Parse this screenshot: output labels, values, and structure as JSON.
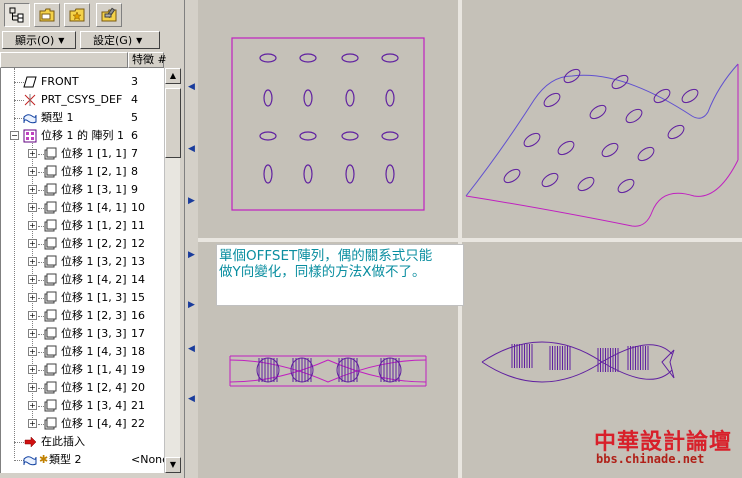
{
  "menus": {
    "display_label": "顯示(O)",
    "settings_label": "設定(G)"
  },
  "tree_header": {
    "feature_col": "特徵 #"
  },
  "tree": {
    "items": [
      {
        "label": "",
        "num": ""
      },
      {
        "label": "FRONT",
        "num": "3"
      },
      {
        "label": "PRT_CSYS_DEF",
        "num": "4"
      },
      {
        "label": "類型 1",
        "num": "5"
      },
      {
        "label": "位移 1 的 陣列 1",
        "num": "6"
      },
      {
        "label": "位移 1 [1, 1]",
        "num": "7"
      },
      {
        "label": "位移 1 [2, 1]",
        "num": "8"
      },
      {
        "label": "位移 1 [3, 1]",
        "num": "9"
      },
      {
        "label": "位移 1 [4, 1]",
        "num": "10"
      },
      {
        "label": "位移 1 [1, 2]",
        "num": "11"
      },
      {
        "label": "位移 1 [2, 2]",
        "num": "12"
      },
      {
        "label": "位移 1 [3, 2]",
        "num": "13"
      },
      {
        "label": "位移 1 [4, 2]",
        "num": "14"
      },
      {
        "label": "位移 1 [1, 3]",
        "num": "15"
      },
      {
        "label": "位移 1 [2, 3]",
        "num": "16"
      },
      {
        "label": "位移 1 [3, 3]",
        "num": "17"
      },
      {
        "label": "位移 1 [4, 3]",
        "num": "18"
      },
      {
        "label": "位移 1 [1, 4]",
        "num": "19"
      },
      {
        "label": "位移 1 [2, 4]",
        "num": "20"
      },
      {
        "label": "位移 1 [3, 4]",
        "num": "21"
      },
      {
        "label": "位移 1 [4, 4]",
        "num": "22"
      },
      {
        "label": "在此插入",
        "num": ""
      },
      {
        "label": "類型 2",
        "num": "<None"
      }
    ]
  },
  "annotation": {
    "line1": "單個OFFSET陣列，偶的關系式只能",
    "line2": "做Y向變化，同樣的方法X做不了。"
  },
  "watermark": {
    "title": "中華設計論壇",
    "url": "bbs.chinade.net"
  },
  "colors": {
    "sketch_magenta": "#c020c0",
    "sketch_purple": "#6020a0",
    "viewport_bg": "#c5c1b8",
    "annotation_text": "#0a8ea0",
    "watermark_red": "#d8202a"
  },
  "icons": {
    "tab1": "model-tree-icon",
    "tab2": "folder-icon",
    "tab3": "favorites-icon",
    "tab4": "tools-icon"
  }
}
